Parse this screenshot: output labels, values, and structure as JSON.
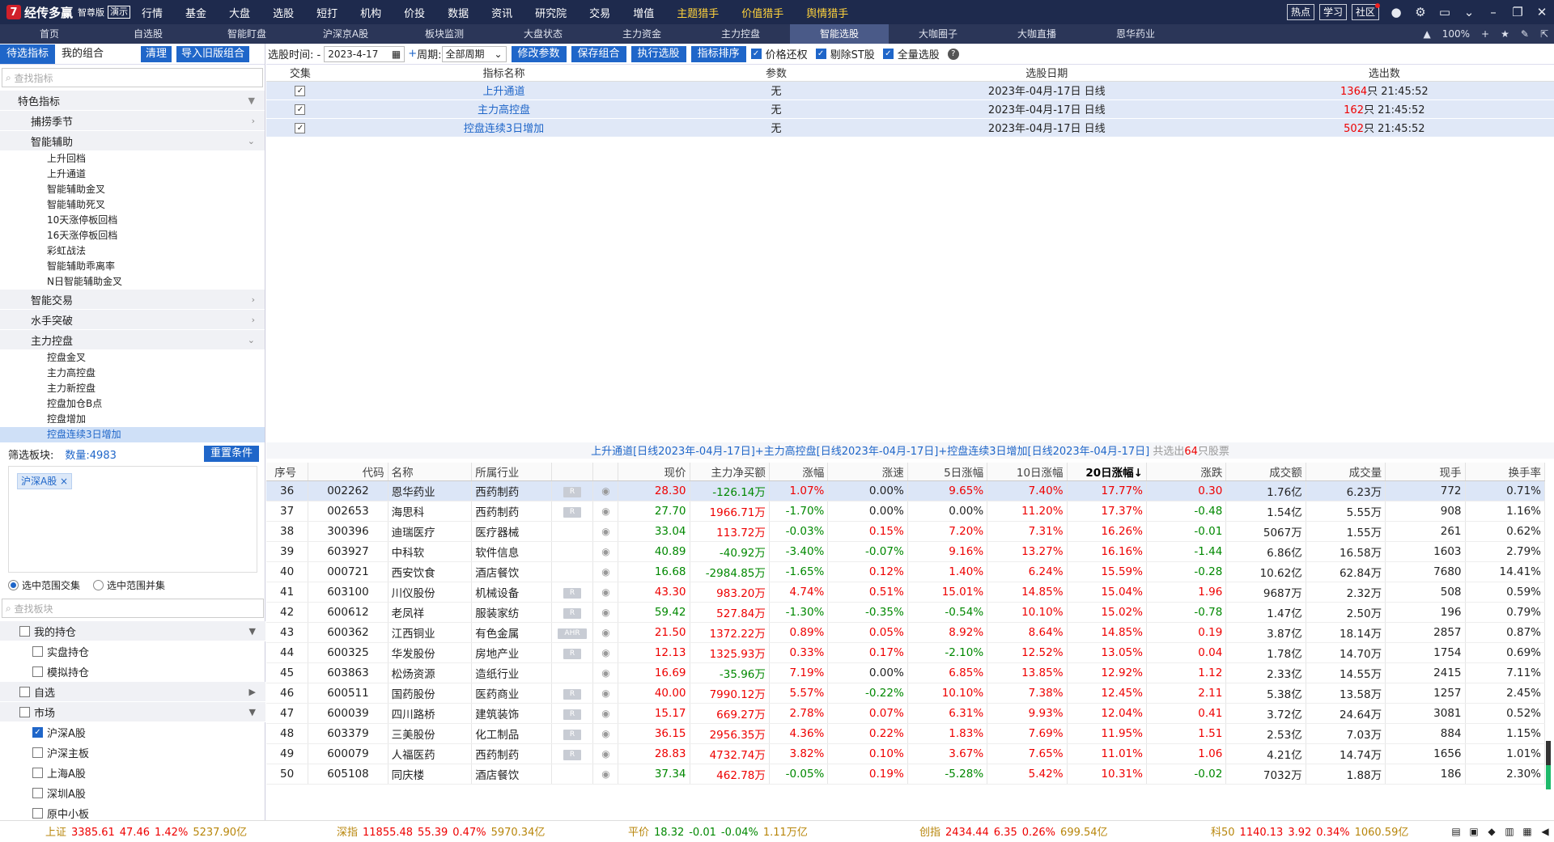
{
  "app": {
    "logo_mark": "7",
    "name": "经传多赢",
    "edition": "智尊版",
    "demo": "演示"
  },
  "menu": [
    "行情",
    "基金",
    "大盘",
    "选股",
    "短打",
    "机构",
    "价投",
    "数据",
    "资讯",
    "研究院",
    "交易",
    "增值"
  ],
  "menu_special": [
    "主题猎手",
    "价值猎手",
    "舆情猎手"
  ],
  "top_buttons": [
    "热点",
    "学习",
    "社区"
  ],
  "top_icons": [
    "user-icon",
    "gear-icon",
    "window-icon",
    "minimize-icon",
    "restore-icon",
    "close-icon"
  ],
  "tabs": [
    "首页",
    "自选股",
    "智能盯盘",
    "沪深京A股",
    "板块监测",
    "大盘状态",
    "主力资金",
    "主力控盘",
    "智能选股",
    "大咖圈子",
    "大咖直播",
    "恩华药业"
  ],
  "active_tab": 8,
  "tab_tools": {
    "zoom": "100%"
  },
  "left": {
    "tab1": "待选指标",
    "tab2": "我的组合",
    "clear": "清理",
    "import": "导入旧版组合",
    "search_placeholder": "查找指标",
    "groups": [
      {
        "label": "特色指标",
        "arrow": "▼",
        "leaves": []
      },
      {
        "label": "捕捞季节",
        "arrow": "›",
        "leaves": []
      },
      {
        "label": "智能辅助",
        "arrow": "⌄",
        "leaves": [
          "上升回档",
          "上升通道",
          "智能辅助金叉",
          "智能辅助死叉",
          "10天涨停板回档",
          "16天涨停板回档",
          "彩虹战法",
          "智能辅助乖离率",
          "N日智能辅助金叉"
        ]
      },
      {
        "label": "智能交易",
        "arrow": "›",
        "leaves": []
      },
      {
        "label": "水手突破",
        "arrow": "›",
        "leaves": []
      },
      {
        "label": "主力控盘",
        "arrow": "⌄",
        "leaves": [
          "控盘金叉",
          "主力高控盘",
          "主力新控盘",
          "控盘加仓B点",
          "控盘增加",
          "控盘连续3日增加"
        ]
      }
    ],
    "selected_leaf": "控盘连续3日增加",
    "filter_label": "筛选板块:",
    "filter_count": "数量:4983",
    "reset": "重置条件",
    "tag": "沪深A股",
    "radio1": "选中范围交集",
    "radio2": "选中范围并集",
    "board_search": "查找板块",
    "boards": [
      {
        "type": "group",
        "label": "我的持仓",
        "arrow": "▼",
        "checked": false
      },
      {
        "type": "leaf",
        "label": "实盘持仓",
        "checked": false
      },
      {
        "type": "leaf",
        "label": "模拟持仓",
        "checked": false
      },
      {
        "type": "group",
        "label": "自选",
        "arrow": "▶",
        "checked": false
      },
      {
        "type": "group",
        "label": "市场",
        "arrow": "▼",
        "checked": false
      },
      {
        "type": "leaf",
        "label": "沪深A股",
        "checked": true
      },
      {
        "type": "leaf",
        "label": "沪深主板",
        "checked": false
      },
      {
        "type": "leaf",
        "label": "上海A股",
        "checked": false
      },
      {
        "type": "leaf",
        "label": "深圳A股",
        "checked": false
      },
      {
        "type": "leaf",
        "label": "原中小板",
        "checked": false
      }
    ]
  },
  "toolbar": {
    "time_label": "选股时间: -",
    "date": "2023-4-17",
    "period_label": "周期:",
    "period": "全部周期",
    "buttons": [
      "修改参数",
      "保存组合",
      "执行选股",
      "指标排序"
    ],
    "checks": [
      {
        "label": "价格还权",
        "on": true
      },
      {
        "label": "剔除ST股",
        "on": true
      },
      {
        "label": "全量选股",
        "on": true
      }
    ]
  },
  "conditions": {
    "headers": [
      "交集",
      "指标名称",
      "参数",
      "选股日期",
      "选出数"
    ],
    "rows": [
      {
        "name": "上升通道",
        "param": "无",
        "date": "2023年-04月-17日 日线",
        "count": "1364",
        "suffix": "只 21:45:52"
      },
      {
        "name": "主力高控盘",
        "param": "无",
        "date": "2023年-04月-17日 日线",
        "count": "162",
        "suffix": "只 21:45:52"
      },
      {
        "name": "控盘连续3日增加",
        "param": "无",
        "date": "2023年-04月-17日 日线",
        "count": "502",
        "suffix": "只 21:45:52"
      }
    ]
  },
  "summary": {
    "text": "上升通道[日线2023年-04月-17日]+主力高控盘[日线2023年-04月-17日]+控盘连续3日增加[日线2023年-04月-17日]",
    "prefix": " 共选出",
    "count": "64",
    "suffix": "只股票"
  },
  "results": {
    "headers": [
      "序号",
      "代码",
      "名称",
      "所属行业",
      "",
      "",
      "现价",
      "主力净买额",
      "涨幅",
      "涨速",
      "5日涨幅",
      "10日涨幅",
      "20日涨幅↓",
      "涨跌",
      "成交额",
      "成交量",
      "现手",
      "换手率"
    ],
    "rows": [
      [
        "36",
        "002262",
        "恩华药业",
        "西药制药",
        "R",
        "28.30",
        "-126.14万",
        "1.07%",
        "0.00%",
        "9.65%",
        "7.40%",
        "17.77%",
        "0.30",
        "1.76亿",
        "6.23万",
        "772",
        "0.71%"
      ],
      [
        "37",
        "002653",
        "海思科",
        "西药制药",
        "R",
        "27.70",
        "1966.71万",
        "-1.70%",
        "0.00%",
        "0.00%",
        "11.20%",
        "17.37%",
        "-0.48",
        "1.54亿",
        "5.55万",
        "908",
        "1.16%"
      ],
      [
        "38",
        "300396",
        "迪瑞医疗",
        "医疗器械",
        "",
        "33.04",
        "113.72万",
        "-0.03%",
        "0.15%",
        "7.20%",
        "7.31%",
        "16.26%",
        "-0.01",
        "5067万",
        "1.55万",
        "261",
        "0.62%"
      ],
      [
        "39",
        "603927",
        "中科软",
        "软件信息",
        "",
        "40.89",
        "-40.92万",
        "-3.40%",
        "-0.07%",
        "9.16%",
        "13.27%",
        "16.16%",
        "-1.44",
        "6.86亿",
        "16.58万",
        "1603",
        "2.79%"
      ],
      [
        "40",
        "000721",
        "西安饮食",
        "酒店餐饮",
        "",
        "16.68",
        "-2984.85万",
        "-1.65%",
        "0.12%",
        "1.40%",
        "6.24%",
        "15.59%",
        "-0.28",
        "10.62亿",
        "62.84万",
        "7680",
        "14.41%"
      ],
      [
        "41",
        "603100",
        "川仪股份",
        "机械设备",
        "R",
        "43.30",
        "983.20万",
        "4.74%",
        "0.51%",
        "15.01%",
        "14.85%",
        "15.04%",
        "1.96",
        "9687万",
        "2.32万",
        "508",
        "0.59%"
      ],
      [
        "42",
        "600612",
        "老凤祥",
        "服装家纺",
        "R",
        "59.42",
        "527.84万",
        "-1.30%",
        "-0.35%",
        "-0.54%",
        "10.10%",
        "15.02%",
        "-0.78",
        "1.47亿",
        "2.50万",
        "196",
        "0.79%"
      ],
      [
        "43",
        "600362",
        "江西铜业",
        "有色金属",
        "AHR",
        "21.50",
        "1372.22万",
        "0.89%",
        "0.05%",
        "8.92%",
        "8.64%",
        "14.85%",
        "0.19",
        "3.87亿",
        "18.14万",
        "2857",
        "0.87%"
      ],
      [
        "44",
        "600325",
        "华发股份",
        "房地产业",
        "R",
        "12.13",
        "1325.93万",
        "0.33%",
        "0.17%",
        "-2.10%",
        "12.52%",
        "13.05%",
        "0.04",
        "1.78亿",
        "14.70万",
        "1754",
        "0.69%"
      ],
      [
        "45",
        "603863",
        "松炀资源",
        "造纸行业",
        "",
        "16.69",
        "-35.96万",
        "7.19%",
        "0.00%",
        "6.85%",
        "13.85%",
        "12.92%",
        "1.12",
        "2.33亿",
        "14.55万",
        "2415",
        "7.11%"
      ],
      [
        "46",
        "600511",
        "国药股份",
        "医药商业",
        "R",
        "40.00",
        "7990.12万",
        "5.57%",
        "-0.22%",
        "10.10%",
        "7.38%",
        "12.45%",
        "2.11",
        "5.38亿",
        "13.58万",
        "1257",
        "2.45%"
      ],
      [
        "47",
        "600039",
        "四川路桥",
        "建筑装饰",
        "R",
        "15.17",
        "669.27万",
        "2.78%",
        "0.07%",
        "6.31%",
        "9.93%",
        "12.04%",
        "0.41",
        "3.72亿",
        "24.64万",
        "3081",
        "0.52%"
      ],
      [
        "48",
        "603379",
        "三美股份",
        "化工制品",
        "R",
        "36.15",
        "2956.35万",
        "4.36%",
        "0.22%",
        "1.83%",
        "7.69%",
        "11.95%",
        "1.51",
        "2.53亿",
        "7.03万",
        "884",
        "1.15%"
      ],
      [
        "49",
        "600079",
        "人福医药",
        "西药制药",
        "R",
        "28.83",
        "4732.74万",
        "3.82%",
        "0.10%",
        "3.67%",
        "7.65%",
        "11.01%",
        "1.06",
        "4.21亿",
        "14.74万",
        "1656",
        "1.01%"
      ],
      [
        "50",
        "605108",
        "同庆楼",
        "酒店餐饮",
        "",
        "37.34",
        "462.78万",
        "-0.05%",
        "0.19%",
        "-5.28%",
        "5.42%",
        "10.31%",
        "-0.02",
        "7032万",
        "1.88万",
        "186",
        "2.30%"
      ]
    ]
  },
  "indices": [
    {
      "name": "上证",
      "val": "3385.61",
      "chg": "47.46",
      "pct": "1.42%",
      "amt": "5237.90亿",
      "dir": "up"
    },
    {
      "name": "深指",
      "val": "11855.48",
      "chg": "55.39",
      "pct": "0.47%",
      "amt": "5970.34亿",
      "dir": "up"
    },
    {
      "name": "平价",
      "val": "18.32",
      "chg": "-0.01",
      "pct": "-0.04%",
      "amt": "1.11万亿",
      "dir": "dn"
    },
    {
      "name": "创指",
      "val": "2434.44",
      "chg": "6.35",
      "pct": "0.26%",
      "amt": "699.54亿",
      "dir": "up"
    },
    {
      "name": "科50",
      "val": "1140.13",
      "chg": "3.92",
      "pct": "0.34%",
      "amt": "1060.59亿",
      "dir": "up"
    }
  ],
  "colors": {
    "nav_bg": "#1e2a4d",
    "accent": "#1f66c9",
    "up": "#e00",
    "down": "#080"
  }
}
